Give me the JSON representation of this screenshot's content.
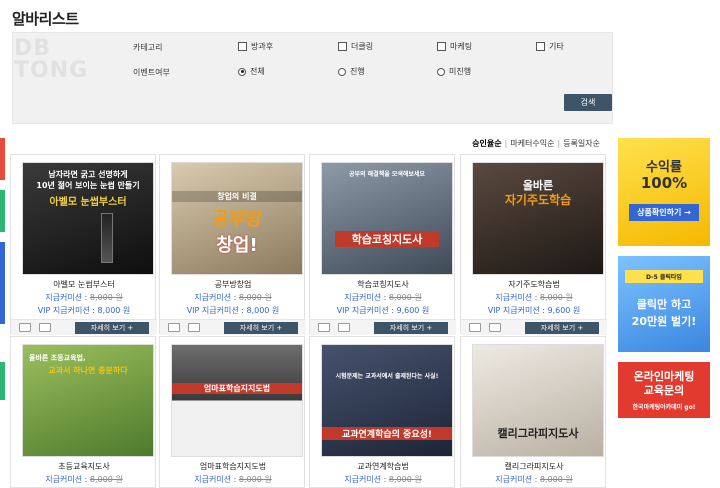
{
  "page": {
    "title": "알바리스트",
    "watermark_line1": "DB",
    "watermark_line2": "TONG"
  },
  "filter": {
    "category_label": "카테고리",
    "categories": [
      "방과후",
      "더클링",
      "마케팅",
      "기타"
    ],
    "event_label": "이벤트여부",
    "events": [
      {
        "label": "전체",
        "selected": true
      },
      {
        "label": "진행",
        "selected": false
      },
      {
        "label": "미진행",
        "selected": false
      }
    ],
    "search_button": "검색"
  },
  "sort": {
    "items": [
      "승인율순",
      "마케터수익순",
      "등록일자순"
    ],
    "active": 0
  },
  "cards": [
    {
      "name": "아벨모 눈썹부스터",
      "price_label": "지급커미션 :",
      "old_price": "8,000 원",
      "vip_label": "VIP 지급커미션 :",
      "vip_price": "8,000 원",
      "thumb_lines": [
        "남자라면 굵고 선명하게",
        "10년 젊어 보이는 눈썹 만들기",
        "아벨모 눈썹부스터"
      ],
      "thumb_bg": "#1c1c1c"
    },
    {
      "name": "공부방창업",
      "price_label": "지급커미션 :",
      "old_price": "8,000 원",
      "vip_label": "VIP 지급커미션 :",
      "vip_price": "8,000 원",
      "thumb_lines": [
        "창업의 비결",
        "공부방",
        "창업!"
      ],
      "thumb_bg": "#c9b79a"
    },
    {
      "name": "학습코칭지도사",
      "price_label": "지급커미션 :",
      "old_price": "8,000 원",
      "vip_label": "VIP 지급커미션 :",
      "vip_price": "9,600 원",
      "thumb_lines": [
        "공부의 해결책을 모색해보세요",
        "학습코칭지도사"
      ],
      "thumb_bg": "#6b7b8e"
    },
    {
      "name": "자기주도학습법",
      "price_label": "지급커미션 :",
      "old_price": "8,000 원",
      "vip_label": "VIP 지급커미션 :",
      "vip_price": "9,600 원",
      "thumb_lines": [
        "올바른",
        "자기주도학습"
      ],
      "thumb_bg": "#3a2f2a"
    },
    {
      "name": "초등교육지도사",
      "price_label": "지급커미션 :",
      "old_price": "8,000 원",
      "vip_label": "",
      "vip_price": "",
      "thumb_lines": [
        "올바른 초등교육법,",
        "교과서 하나면 충분하다"
      ],
      "thumb_bg": "#7a9b4a"
    },
    {
      "name": "엄마표학습지지도법",
      "price_label": "지급커미션 :",
      "old_price": "8,000 원",
      "vip_label": "",
      "vip_price": "",
      "thumb_lines": [
        "엄마표학습지지도법"
      ],
      "thumb_bg": "#5a5a5a"
    },
    {
      "name": "교과연계학습법",
      "price_label": "지급커미션 :",
      "old_price": "8,000 원",
      "vip_label": "",
      "vip_price": "",
      "thumb_lines": [
        "시험문제는 교과서에서 출제된다는 사실!",
        "교과연계학습의 중요성!"
      ],
      "thumb_bg": "#2f3a52"
    },
    {
      "name": "캘리그라피지도사",
      "price_label": "지급커미션 :",
      "old_price": "8,000 원",
      "vip_label": "",
      "vip_price": "",
      "thumb_lines": [
        "캘리그라피지도사"
      ],
      "thumb_bg": "#d8d2c8"
    }
  ],
  "detail_button": "자세히 보기 +",
  "banners": [
    {
      "line1": "수익률",
      "line2": "100%",
      "line3": "상품확인하기 →"
    },
    {
      "line1": "D-5 클릭타임",
      "line2": "클릭만 하고",
      "line3": "20만원 벌기!"
    },
    {
      "line1": "온라인마케팅",
      "line2": "교육문의",
      "line3": "한국마케팅아카데미 go!"
    }
  ]
}
